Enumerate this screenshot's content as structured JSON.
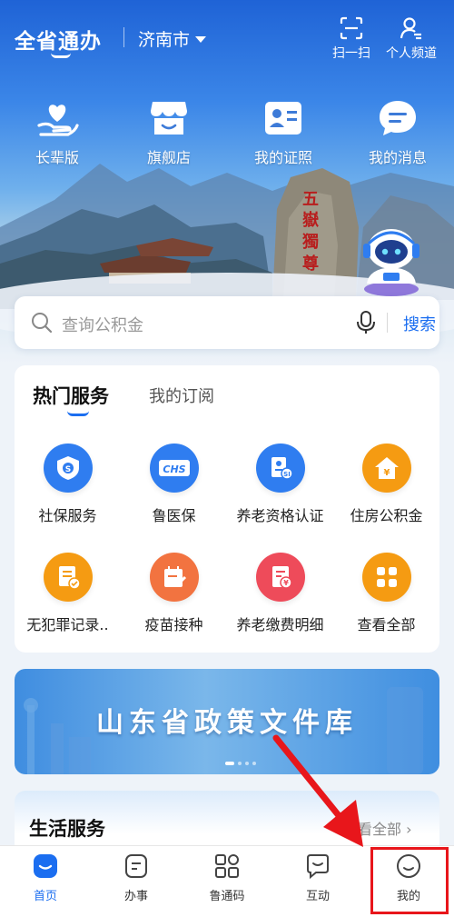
{
  "header": {
    "brand": "全省通办",
    "city": "济南市",
    "scan_label": "扫一扫",
    "personal_label": "个人频道"
  },
  "quick_entries": [
    {
      "label": "长辈版",
      "icon": "heart-hand-icon"
    },
    {
      "label": "旗舰店",
      "icon": "store-icon"
    },
    {
      "label": "我的证照",
      "icon": "id-card-icon"
    },
    {
      "label": "我的消息",
      "icon": "message-icon"
    }
  ],
  "search": {
    "placeholder": "查询公积金",
    "button": "搜索"
  },
  "services": {
    "tab_active": "热门服务",
    "tab_other": "我的订阅",
    "items": [
      {
        "label": "社保服务",
        "icon": "shield-icon",
        "color": "#2f7df0"
      },
      {
        "label": "鲁医保",
        "icon": "chs-icon",
        "color": "#2f7df0"
      },
      {
        "label": "养老资格认证",
        "icon": "certificate-icon",
        "color": "#2f7df0"
      },
      {
        "label": "住房公积金",
        "icon": "house-icon",
        "color": "#f59b12"
      },
      {
        "label": "无犯罪记录..",
        "icon": "record-icon",
        "color": "#f59b12"
      },
      {
        "label": "疫苗接种",
        "icon": "calendar-icon",
        "color": "#f27340"
      },
      {
        "label": "养老缴费明细",
        "icon": "bill-icon",
        "color": "#ee4b5a"
      },
      {
        "label": "查看全部",
        "icon": "grid-icon",
        "color": "#f59b12"
      }
    ]
  },
  "banner": {
    "title": "山东省政策文件库"
  },
  "life_services": {
    "title": "生活服务",
    "more": "查看全部"
  },
  "bottom_nav": [
    {
      "label": "首页",
      "icon": "home-icon",
      "active": true
    },
    {
      "label": "办事",
      "icon": "tasks-icon",
      "active": false
    },
    {
      "label": "鲁通码",
      "icon": "qr-code-icon",
      "active": false
    },
    {
      "label": "互动",
      "icon": "chat-icon",
      "active": false
    },
    {
      "label": "我的",
      "icon": "smile-icon",
      "active": false
    }
  ],
  "colors": {
    "accent": "#1b6ef0",
    "annotation": "#e8161b"
  }
}
